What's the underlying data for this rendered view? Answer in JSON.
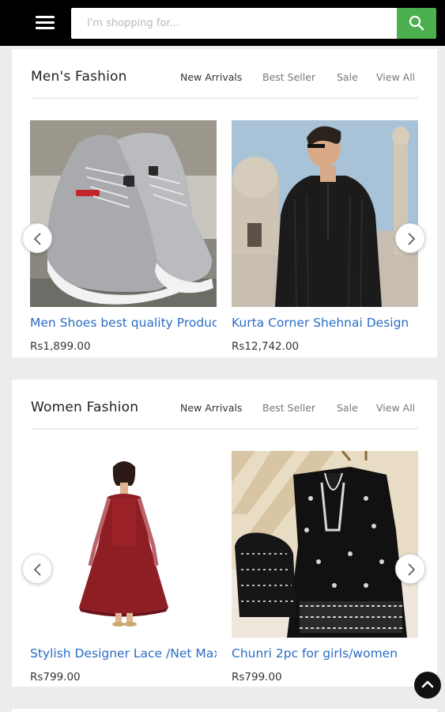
{
  "search": {
    "placeholder": "I'm shopping for..."
  },
  "icons": {
    "menu": "hamburger-menu-icon",
    "search": "magnifier-icon",
    "prev": "chevron-left-icon",
    "next": "chevron-right-icon",
    "top": "chevron-up-icon"
  },
  "colors": {
    "header_bg": "#000000",
    "search_button": "#4caf50",
    "product_link": "#2a6cc4",
    "page_bg": "#ececec"
  },
  "sections": [
    {
      "title": "Men's Fashion",
      "tabs": [
        "New Arrivals",
        "Best Seller",
        "Sale",
        "View All"
      ],
      "products": [
        {
          "name": "Men Shoes best quality Product",
          "price": "Rs1,899.00"
        },
        {
          "name": "Kurta Corner Shehnai Design",
          "price": "Rs12,742.00"
        }
      ]
    },
    {
      "title": "Women Fashion",
      "tabs": [
        "New Arrivals",
        "Best Seller",
        "Sale",
        "View All"
      ],
      "products": [
        {
          "name": "Stylish Designer Lace /Net Maxi",
          "price": "Rs799.00"
        },
        {
          "name": "Chunri 2pc for girls/women",
          "price": "Rs799.00"
        }
      ]
    }
  ]
}
